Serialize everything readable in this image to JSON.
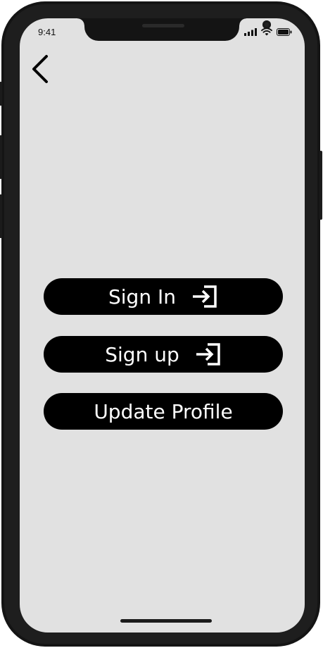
{
  "status_bar": {
    "time": "9:41",
    "signal_icon": "cellular-signal-icon",
    "wifi_icon": "wifi-icon",
    "battery_icon": "battery-icon"
  },
  "nav": {
    "back_icon": "chevron-left-icon"
  },
  "buttons": [
    {
      "label": "Sign In",
      "icon": "sign-in-icon"
    },
    {
      "label": "Sign up",
      "icon": "sign-in-icon"
    },
    {
      "label": "Update Profile"
    }
  ],
  "colors": {
    "screen_background": "#e1e1e1",
    "button_background": "#000000",
    "button_text": "#ffffff",
    "device_frame": "#141414"
  }
}
